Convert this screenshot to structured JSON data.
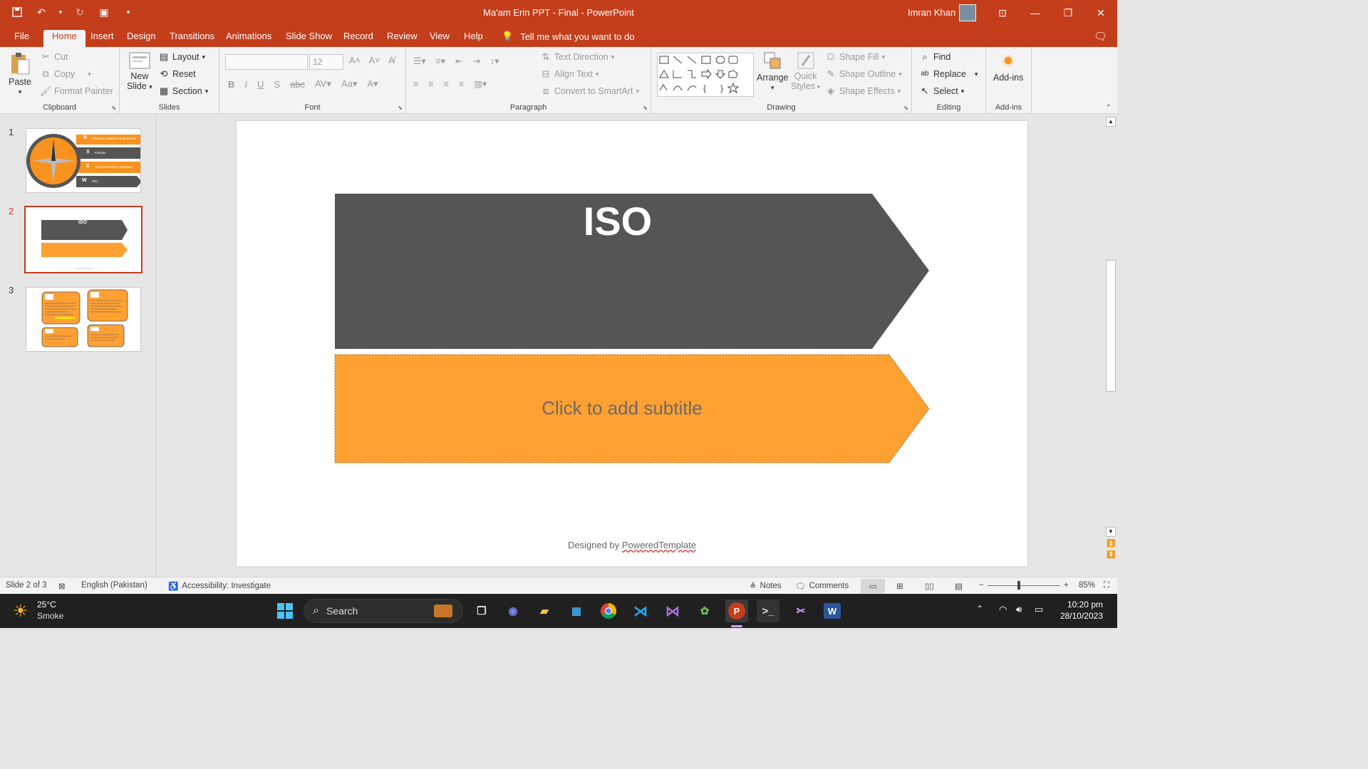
{
  "app": {
    "doc_title": "Ma'am Erin PPT - Final  -  PowerPoint",
    "user_name": "Imran Khan"
  },
  "tabs": [
    "File",
    "Home",
    "Insert",
    "Design",
    "Transitions",
    "Animations",
    "Slide Show",
    "Record",
    "Review",
    "View",
    "Help"
  ],
  "active_tab": "Home",
  "tell_me": "Tell me what you want to do",
  "ribbon": {
    "clipboard": {
      "paste": "Paste",
      "cut": "Cut",
      "copy": "Copy",
      "format_painter": "Format Painter",
      "label": "Clipboard"
    },
    "slides": {
      "new_slide_1": "New",
      "new_slide_2": "Slide",
      "layout": "Layout",
      "reset": "Reset",
      "section": "Section",
      "label": "Slides"
    },
    "font": {
      "font_name": "",
      "font_size": "12",
      "label": "Font"
    },
    "paragraph": {
      "text_direction": "Text Direction",
      "align_text": "Align Text",
      "convert_smartart": "Convert to SmartArt",
      "label": "Paragraph"
    },
    "drawing": {
      "arrange": "Arrange",
      "quick_styles_1": "Quick",
      "quick_styles_2": "Styles",
      "shape_fill": "Shape Fill",
      "shape_outline": "Shape Outline",
      "shape_effects": "Shape Effects",
      "label": "Drawing"
    },
    "editing": {
      "find": "Find",
      "replace": "Replace",
      "select": "Select",
      "label": "Editing"
    },
    "addins": {
      "addins": "Add-ins",
      "label": "Add-ins"
    }
  },
  "thumbnails": [
    {
      "number": "1",
      "rows": [
        {
          "letter": "N",
          "text": "Ultimate Customer Experience"
        },
        {
          "letter": "S",
          "text": "Policies"
        },
        {
          "letter": "E",
          "text": "Environmental Humanities"
        },
        {
          "letter": "W",
          "text": "ISO"
        }
      ]
    },
    {
      "number": "2",
      "title": "ISO"
    },
    {
      "number": "3"
    }
  ],
  "slide": {
    "title": "ISO",
    "subtitle_placeholder": "Click to add subtitle",
    "footer_prefix": "Designed by ",
    "footer_link": "PoweredTemplate"
  },
  "statusbar": {
    "slide_info": "Slide 2 of 3",
    "language": "English (Pakistan)",
    "accessibility": "Accessibility: Investigate",
    "notes": "Notes",
    "comments": "Comments",
    "zoom": "85%"
  },
  "taskbar": {
    "weather_temp": "25°C",
    "weather_desc": "Smoke",
    "search": "Search",
    "time": "10:20 pm",
    "date": "28/10/2023"
  },
  "colors": {
    "accent": "#c43e1c",
    "slide_dark": "#555555",
    "slide_orange": "#ffa033"
  }
}
